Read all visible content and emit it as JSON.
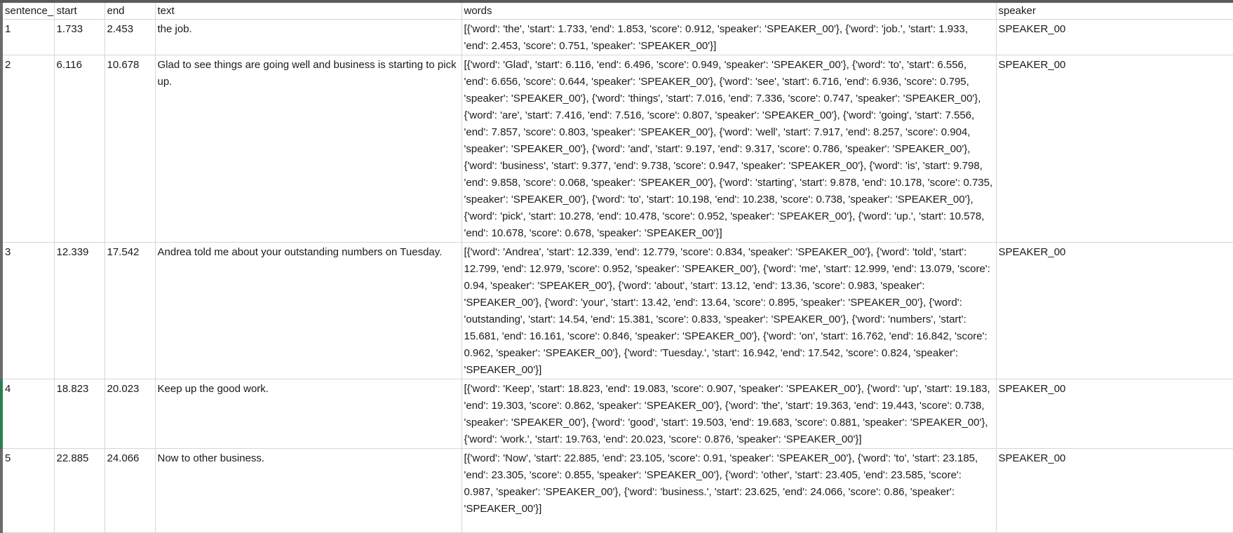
{
  "columns": [
    "sentence_",
    "start",
    "end",
    "text",
    "words",
    "speaker"
  ],
  "rows": [
    {
      "sentence_id": "1",
      "start": "1.733",
      "end": "2.453",
      "text": "the job.",
      "words": "[{'word': 'the', 'start': 1.733, 'end': 1.853, 'score': 0.912, 'speaker': 'SPEAKER_00'}, {'word': 'job.', 'start': 1.933, 'end': 2.453, 'score': 0.751, 'speaker': 'SPEAKER_00'}]",
      "speaker": "SPEAKER_00"
    },
    {
      "sentence_id": "2",
      "start": "6.116",
      "end": "10.678",
      "text": "Glad to see things are going well and business is starting to pick up.",
      "words": "[{'word': 'Glad', 'start': 6.116, 'end': 6.496, 'score': 0.949, 'speaker': 'SPEAKER_00'}, {'word': 'to', 'start': 6.556, 'end': 6.656, 'score': 0.644, 'speaker': 'SPEAKER_00'}, {'word': 'see', 'start': 6.716, 'end': 6.936, 'score': 0.795, 'speaker': 'SPEAKER_00'}, {'word': 'things', 'start': 7.016, 'end': 7.336, 'score': 0.747, 'speaker': 'SPEAKER_00'}, {'word': 'are', 'start': 7.416, 'end': 7.516, 'score': 0.807, 'speaker': 'SPEAKER_00'}, {'word': 'going', 'start': 7.556, 'end': 7.857, 'score': 0.803, 'speaker': 'SPEAKER_00'}, {'word': 'well', 'start': 7.917, 'end': 8.257, 'score': 0.904, 'speaker': 'SPEAKER_00'}, {'word': 'and', 'start': 9.197, 'end': 9.317, 'score': 0.786, 'speaker': 'SPEAKER_00'}, {'word': 'business', 'start': 9.377, 'end': 9.738, 'score': 0.947, 'speaker': 'SPEAKER_00'}, {'word': 'is', 'start': 9.798, 'end': 9.858, 'score': 0.068, 'speaker': 'SPEAKER_00'}, {'word': 'starting', 'start': 9.878, 'end': 10.178, 'score': 0.735, 'speaker': 'SPEAKER_00'}, {'word': 'to', 'start': 10.198, 'end': 10.238, 'score': 0.738, 'speaker': 'SPEAKER_00'}, {'word': 'pick', 'start': 10.278, 'end': 10.478, 'score': 0.952, 'speaker': 'SPEAKER_00'}, {'word': 'up.', 'start': 10.578, 'end': 10.678, 'score': 0.678, 'speaker': 'SPEAKER_00'}]",
      "speaker": "SPEAKER_00"
    },
    {
      "sentence_id": "3",
      "start": "12.339",
      "end": "17.542",
      "text": "Andrea told me about your outstanding numbers on Tuesday.",
      "words": "[{'word': 'Andrea', 'start': 12.339, 'end': 12.779, 'score': 0.834, 'speaker': 'SPEAKER_00'}, {'word': 'told', 'start': 12.799, 'end': 12.979, 'score': 0.952, 'speaker': 'SPEAKER_00'}, {'word': 'me', 'start': 12.999, 'end': 13.079, 'score': 0.94, 'speaker': 'SPEAKER_00'}, {'word': 'about', 'start': 13.12, 'end': 13.36, 'score': 0.983, 'speaker': 'SPEAKER_00'}, {'word': 'your', 'start': 13.42, 'end': 13.64, 'score': 0.895, 'speaker': 'SPEAKER_00'}, {'word': 'outstanding', 'start': 14.54, 'end': 15.381, 'score': 0.833, 'speaker': 'SPEAKER_00'}, {'word': 'numbers', 'start': 15.681, 'end': 16.161, 'score': 0.846, 'speaker': 'SPEAKER_00'}, {'word': 'on', 'start': 16.762, 'end': 16.842, 'score': 0.962, 'speaker': 'SPEAKER_00'}, {'word': 'Tuesday.', 'start': 16.942, 'end': 17.542, 'score': 0.824, 'speaker': 'SPEAKER_00'}]",
      "speaker": "SPEAKER_00"
    },
    {
      "sentence_id": "4",
      "start": "18.823",
      "end": "20.023",
      "text": "Keep up the good work.",
      "words": "[{'word': 'Keep', 'start': 18.823, 'end': 19.083, 'score': 0.907, 'speaker': 'SPEAKER_00'}, {'word': 'up', 'start': 19.183, 'end': 19.303, 'score': 0.862, 'speaker': 'SPEAKER_00'}, {'word': 'the', 'start': 19.363, 'end': 19.443, 'score': 0.738, 'speaker': 'SPEAKER_00'}, {'word': 'good', 'start': 19.503, 'end': 19.683, 'score': 0.881, 'speaker': 'SPEAKER_00'}, {'word': 'work.', 'start': 19.763, 'end': 20.023, 'score': 0.876, 'speaker': 'SPEAKER_00'}]",
      "speaker": "SPEAKER_00"
    },
    {
      "sentence_id": "5",
      "start": "22.885",
      "end": "24.066",
      "text": "Now to other business.",
      "words": "[{'word': 'Now', 'start': 22.885, 'end': 23.105, 'score': 0.91, 'speaker': 'SPEAKER_00'}, {'word': 'to', 'start': 23.185, 'end': 23.305, 'score': 0.855, 'speaker': 'SPEAKER_00'}, {'word': 'other', 'start': 23.405, 'end': 23.585, 'score': 0.987, 'speaker': 'SPEAKER_00'}, {'word': 'business.', 'start': 23.625, 'end': 24.066, 'score': 0.86, 'speaker': 'SPEAKER_00'}]",
      "speaker": "SPEAKER_00"
    }
  ]
}
